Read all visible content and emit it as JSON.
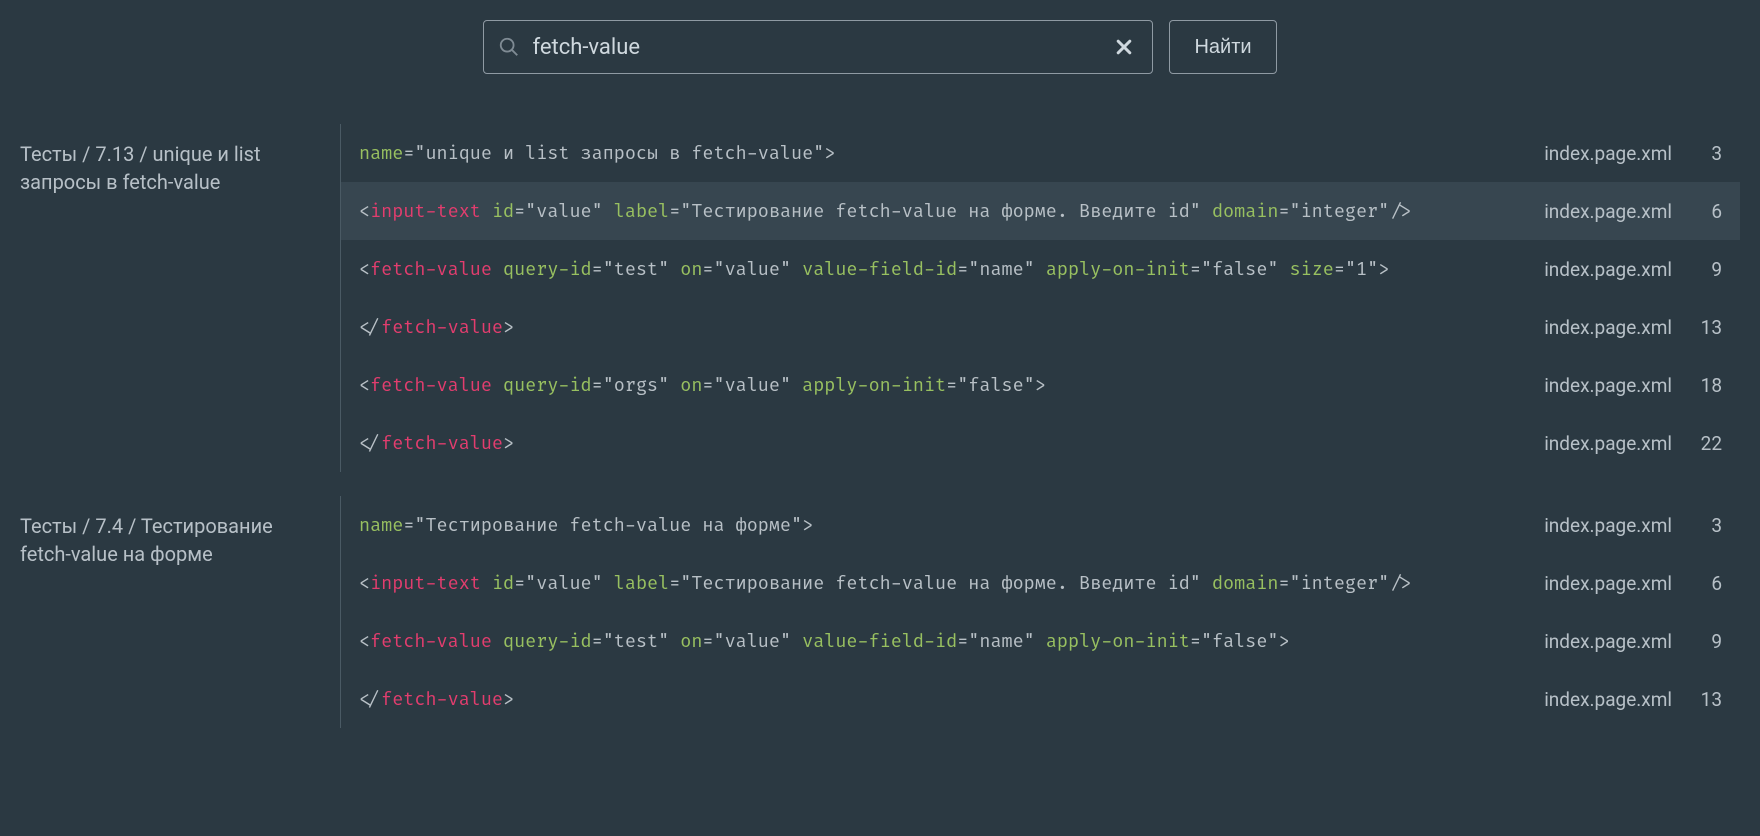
{
  "search": {
    "value": "fetch-value",
    "placeholder": "",
    "button_label": "Найти"
  },
  "groups": [
    {
      "title": "Тесты / 7.13 / unique и list запросы в fetch-value",
      "rows": [
        {
          "file": "index.page.xml",
          "line": 3,
          "highlighted": false,
          "tokens": [
            {
              "c": "attr",
              "t": "name"
            },
            {
              "c": "punc",
              "t": "="
            },
            {
              "c": "str",
              "t": "\"unique и list запросы в fetch-value\""
            },
            {
              "c": "punc",
              "t": ">"
            }
          ]
        },
        {
          "file": "index.page.xml",
          "line": 6,
          "highlighted": true,
          "tokens": [
            {
              "c": "punc",
              "t": "<"
            },
            {
              "c": "tag",
              "t": "input-text"
            },
            {
              "c": "punc",
              "t": " "
            },
            {
              "c": "attr",
              "t": "id"
            },
            {
              "c": "punc",
              "t": "="
            },
            {
              "c": "str",
              "t": "\"value\""
            },
            {
              "c": "punc",
              "t": " "
            },
            {
              "c": "attr",
              "t": "label"
            },
            {
              "c": "punc",
              "t": "="
            },
            {
              "c": "str",
              "t": "\"Тестирование fetch-value на форме. Введите id\""
            },
            {
              "c": "punc",
              "t": " "
            },
            {
              "c": "attr",
              "t": "domain"
            },
            {
              "c": "punc",
              "t": "="
            },
            {
              "c": "str",
              "t": "\"integer\""
            },
            {
              "c": "punc",
              "t": "/>"
            }
          ]
        },
        {
          "file": "index.page.xml",
          "line": 9,
          "highlighted": false,
          "tokens": [
            {
              "c": "punc",
              "t": "<"
            },
            {
              "c": "tag",
              "t": "fetch-value"
            },
            {
              "c": "punc",
              "t": " "
            },
            {
              "c": "attr",
              "t": "query-id"
            },
            {
              "c": "punc",
              "t": "="
            },
            {
              "c": "str",
              "t": "\"test\""
            },
            {
              "c": "punc",
              "t": " "
            },
            {
              "c": "attr",
              "t": "on"
            },
            {
              "c": "punc",
              "t": "="
            },
            {
              "c": "str",
              "t": "\"value\""
            },
            {
              "c": "punc",
              "t": " "
            },
            {
              "c": "attr",
              "t": "value-field-id"
            },
            {
              "c": "punc",
              "t": "="
            },
            {
              "c": "str",
              "t": "\"name\""
            },
            {
              "c": "punc",
              "t": " "
            },
            {
              "c": "attr",
              "t": "apply-on-init"
            },
            {
              "c": "punc",
              "t": "="
            },
            {
              "c": "str",
              "t": "\"false\""
            },
            {
              "c": "punc",
              "t": " "
            },
            {
              "c": "attr",
              "t": "size"
            },
            {
              "c": "punc",
              "t": "="
            },
            {
              "c": "str",
              "t": "\"1\""
            },
            {
              "c": "punc",
              "t": ">"
            }
          ]
        },
        {
          "file": "index.page.xml",
          "line": 13,
          "highlighted": false,
          "tokens": [
            {
              "c": "punc",
              "t": "</"
            },
            {
              "c": "tag",
              "t": "fetch-value"
            },
            {
              "c": "punc",
              "t": ">"
            }
          ]
        },
        {
          "file": "index.page.xml",
          "line": 18,
          "highlighted": false,
          "tokens": [
            {
              "c": "punc",
              "t": "<"
            },
            {
              "c": "tag",
              "t": "fetch-value"
            },
            {
              "c": "punc",
              "t": " "
            },
            {
              "c": "attr",
              "t": "query-id"
            },
            {
              "c": "punc",
              "t": "="
            },
            {
              "c": "str",
              "t": "\"orgs\""
            },
            {
              "c": "punc",
              "t": " "
            },
            {
              "c": "attr",
              "t": "on"
            },
            {
              "c": "punc",
              "t": "="
            },
            {
              "c": "str",
              "t": "\"value\""
            },
            {
              "c": "punc",
              "t": " "
            },
            {
              "c": "attr",
              "t": "apply-on-init"
            },
            {
              "c": "punc",
              "t": "="
            },
            {
              "c": "str",
              "t": "\"false\""
            },
            {
              "c": "punc",
              "t": ">"
            }
          ]
        },
        {
          "file": "index.page.xml",
          "line": 22,
          "highlighted": false,
          "tokens": [
            {
              "c": "punc",
              "t": "</"
            },
            {
              "c": "tag",
              "t": "fetch-value"
            },
            {
              "c": "punc",
              "t": ">"
            }
          ]
        }
      ]
    },
    {
      "title": "Тесты / 7.4 / Тестирование fetch-value на форме",
      "rows": [
        {
          "file": "index.page.xml",
          "line": 3,
          "highlighted": false,
          "tokens": [
            {
              "c": "attr",
              "t": "name"
            },
            {
              "c": "punc",
              "t": "="
            },
            {
              "c": "str",
              "t": "\"Тестирование fetch-value на форме\""
            },
            {
              "c": "punc",
              "t": ">"
            }
          ]
        },
        {
          "file": "index.page.xml",
          "line": 6,
          "highlighted": false,
          "tokens": [
            {
              "c": "punc",
              "t": "<"
            },
            {
              "c": "tag",
              "t": "input-text"
            },
            {
              "c": "punc",
              "t": " "
            },
            {
              "c": "attr",
              "t": "id"
            },
            {
              "c": "punc",
              "t": "="
            },
            {
              "c": "str",
              "t": "\"value\""
            },
            {
              "c": "punc",
              "t": " "
            },
            {
              "c": "attr",
              "t": "label"
            },
            {
              "c": "punc",
              "t": "="
            },
            {
              "c": "str",
              "t": "\"Тестирование fetch-value на форме. Введите id\""
            },
            {
              "c": "punc",
              "t": " "
            },
            {
              "c": "attr",
              "t": "domain"
            },
            {
              "c": "punc",
              "t": "="
            },
            {
              "c": "str",
              "t": "\"integer\""
            },
            {
              "c": "punc",
              "t": "/>"
            }
          ]
        },
        {
          "file": "index.page.xml",
          "line": 9,
          "highlighted": false,
          "tokens": [
            {
              "c": "punc",
              "t": "<"
            },
            {
              "c": "tag",
              "t": "fetch-value"
            },
            {
              "c": "punc",
              "t": " "
            },
            {
              "c": "attr",
              "t": "query-id"
            },
            {
              "c": "punc",
              "t": "="
            },
            {
              "c": "str",
              "t": "\"test\""
            },
            {
              "c": "punc",
              "t": " "
            },
            {
              "c": "attr",
              "t": "on"
            },
            {
              "c": "punc",
              "t": "="
            },
            {
              "c": "str",
              "t": "\"value\""
            },
            {
              "c": "punc",
              "t": " "
            },
            {
              "c": "attr",
              "t": "value-field-id"
            },
            {
              "c": "punc",
              "t": "="
            },
            {
              "c": "str",
              "t": "\"name\""
            },
            {
              "c": "punc",
              "t": " "
            },
            {
              "c": "attr",
              "t": "apply-on-init"
            },
            {
              "c": "punc",
              "t": "="
            },
            {
              "c": "str",
              "t": "\"false\""
            },
            {
              "c": "punc",
              "t": ">"
            }
          ]
        },
        {
          "file": "index.page.xml",
          "line": 13,
          "highlighted": false,
          "tokens": [
            {
              "c": "punc",
              "t": "</"
            },
            {
              "c": "tag",
              "t": "fetch-value"
            },
            {
              "c": "punc",
              "t": ">"
            }
          ]
        }
      ]
    }
  ]
}
